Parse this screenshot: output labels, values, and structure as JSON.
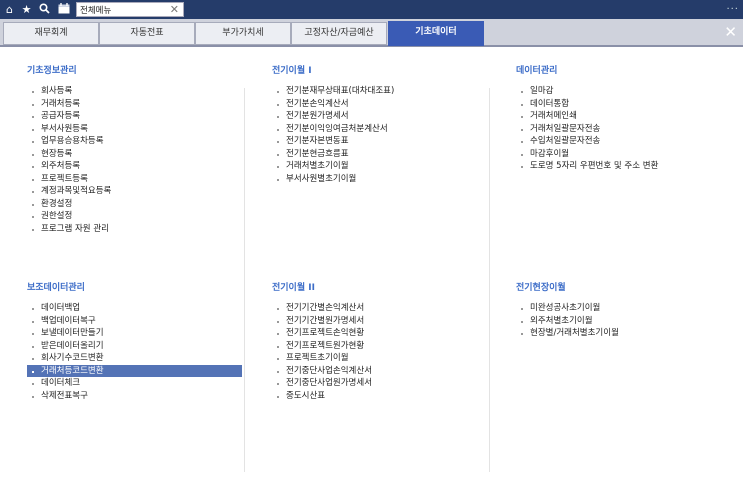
{
  "topbar": {
    "icons": [
      "home-icon",
      "star-icon",
      "search-icon",
      "calendar-icon"
    ],
    "open_tab": "전체메뉴",
    "close_glyph": "✕",
    "more_glyph": "..."
  },
  "tabs": [
    {
      "label": "재무회계",
      "active": false
    },
    {
      "label": "자동전표",
      "active": false
    },
    {
      "label": "부가가치세",
      "active": false
    },
    {
      "label": "고정자산/자금예산",
      "active": false
    },
    {
      "label": "기초데이터",
      "active": true
    }
  ],
  "close_glyph": "✕",
  "sections": {
    "s1": {
      "title": "기초정보관리",
      "items": [
        "회사등록",
        "거래처등록",
        "공급자등록",
        "부서사원등록",
        "업무용승용차등록",
        "현장등록",
        "외주처등록",
        "프로젝트등록",
        "계정과목및적요등록",
        "환경설정",
        "권한설정",
        "프로그램 자원 관리"
      ]
    },
    "s2": {
      "title": "전기이월 I",
      "items": [
        "전기분재무상태표(대차대조표)",
        "전기분손익계산서",
        "전기분원가명세서",
        "전기분이익잉여금처분계산서",
        "전기분자본변동표",
        "전기분현금흐름표",
        "거래처별초기이월",
        "부서사원별초기이월"
      ]
    },
    "s3": {
      "title": "데이터관리",
      "items": [
        "일마감",
        "데이터통합",
        "거래처메인쇄",
        "거래처일괄문자전송",
        "수입처일괄문자전송",
        "마감후이월",
        "도로명 5자리 우편번호 및 주소 변환"
      ]
    },
    "s4": {
      "title": "보조데이터관리",
      "items": [
        "데이터백업",
        "백업데이터복구",
        "보낼데이터만들기",
        "받은데이터올리기",
        "회사기수코드변환",
        "거래처등코드변환",
        "데이터체크",
        "삭제전표복구"
      ],
      "selected_index": 5
    },
    "s5": {
      "title": "전기이월 II",
      "items": [
        "전기기간별손익계산서",
        "전기기간별원가명세서",
        "전기프로젝트손익현황",
        "전기프로젝트원가현황",
        "프로젝트초기이월",
        "전기중단사업손익계산서",
        "전기중단사업원가명세서",
        "중도시산표"
      ]
    },
    "s6": {
      "title": "전기현장이월",
      "items": [
        "미완성공사초기이월",
        "외주처별초기이월",
        "현장별/거래처별초기이월"
      ]
    }
  }
}
